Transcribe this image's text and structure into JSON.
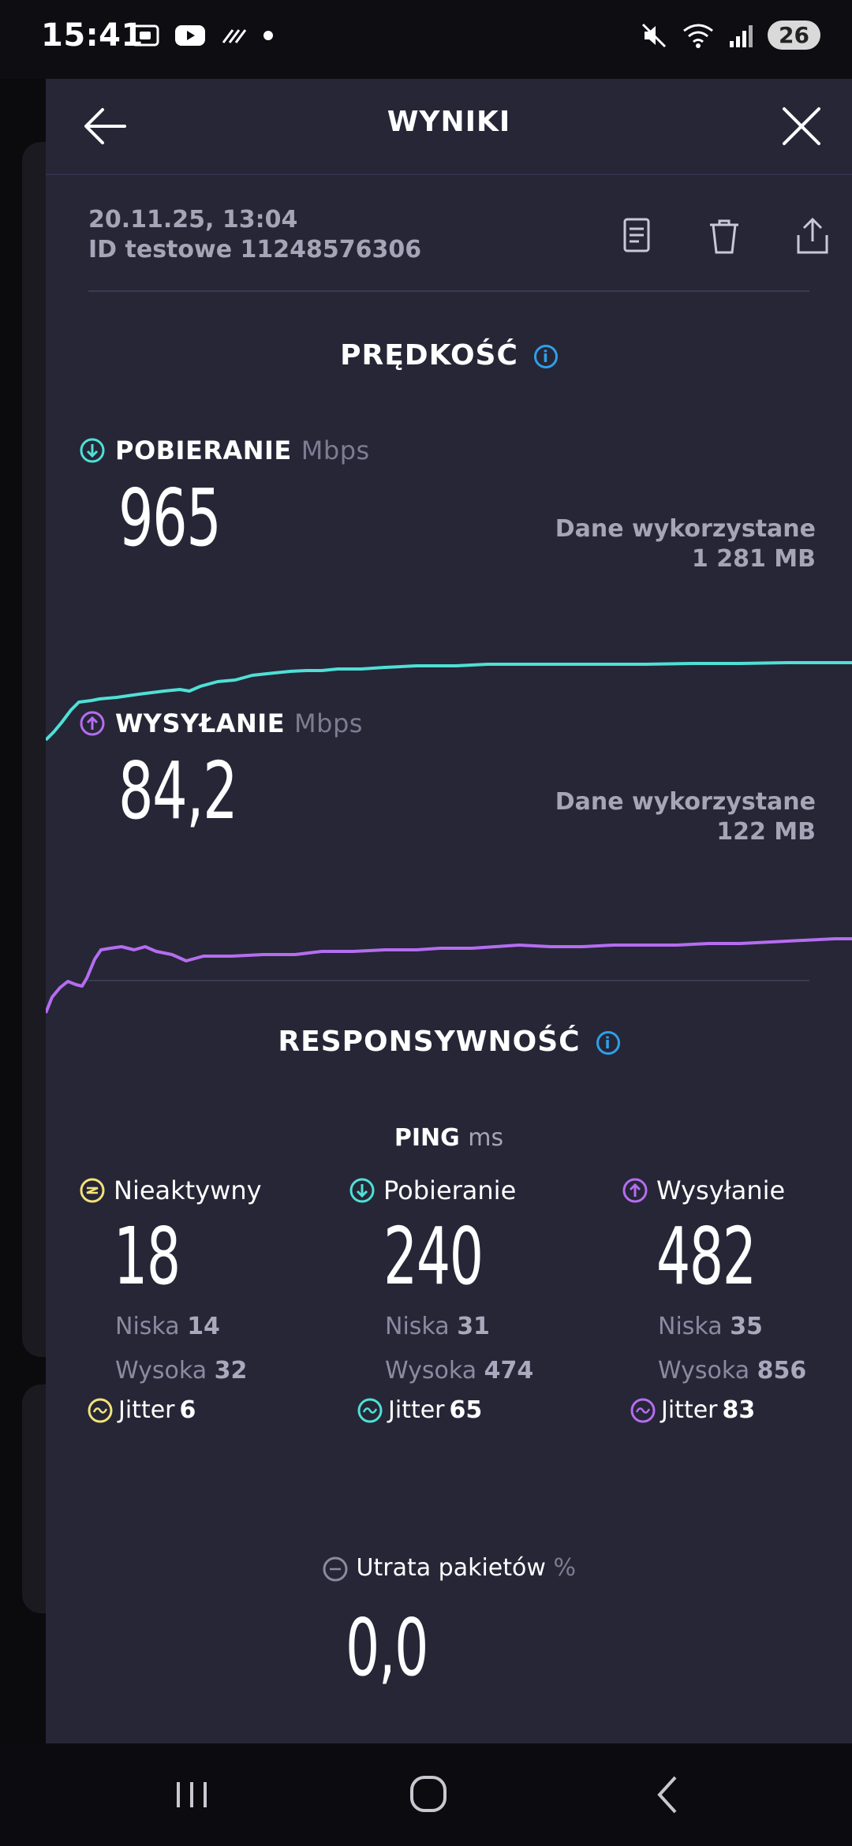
{
  "status_bar": {
    "time": "15:41",
    "battery": "26"
  },
  "header": {
    "title": "WYNIKI"
  },
  "meta": {
    "datetime": "20.11.25, 13:04",
    "test_id": "ID testowe 11248576306"
  },
  "speed": {
    "title": "PRĘDKOŚĆ",
    "download": {
      "label": "POBIERANIE",
      "unit": "Mbps",
      "value": "965",
      "used_label": "Dane wykorzystane",
      "used_value": "1 281 MB"
    },
    "upload": {
      "label": "WYSYŁANIE",
      "unit": "Mbps",
      "value": "84,2",
      "used_label": "Dane wykorzystane",
      "used_value": "122 MB"
    }
  },
  "responsiveness": {
    "title": "RESPONSYWNOŚĆ",
    "ping_label": "PING",
    "ping_unit": "ms",
    "columns": [
      {
        "label": "Nieaktywny",
        "value": "18",
        "low_label": "Niska",
        "low": "14",
        "high_label": "Wysoka",
        "high": "32",
        "jitter_label": "Jitter",
        "jitter": "6"
      },
      {
        "label": "Pobieranie",
        "value": "240",
        "low_label": "Niska",
        "low": "31",
        "high_label": "Wysoka",
        "high": "474",
        "jitter_label": "Jitter",
        "jitter": "65"
      },
      {
        "label": "Wysyłanie",
        "value": "482",
        "low_label": "Niska",
        "low": "35",
        "high_label": "Wysoka",
        "high": "856",
        "jitter_label": "Jitter",
        "jitter": "83"
      }
    ],
    "packet_loss": {
      "label": "Utrata pakietów",
      "unit": "%",
      "value": "0,0"
    }
  },
  "colors": {
    "download": "#4fe0d6",
    "upload": "#b56df0",
    "idle": "#f2e27a",
    "info": "#2f9fe8",
    "sheet": "#262637"
  }
}
